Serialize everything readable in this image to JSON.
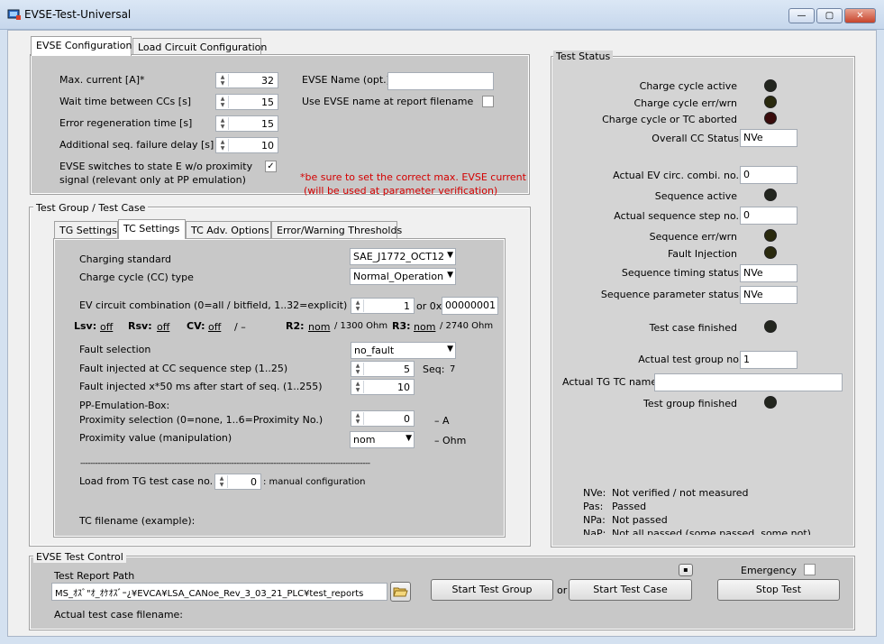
{
  "window": {
    "title": "EVSE-Test-Universal",
    "minimize": "—",
    "maximize": "▢",
    "close": "✕"
  },
  "config_tabs": [
    "EVSE Configuration",
    "Load Circuit Configuration"
  ],
  "config": {
    "max_current_label": "Max. current [A]*",
    "max_current": "32",
    "wait_time_label": "Wait time between CCs [s]",
    "wait_time": "15",
    "error_regen_label": "Error regeneration time [s]",
    "error_regen": "15",
    "add_seq_failure_label": "Additional seq. failure delay [s]",
    "add_seq_failure": "10",
    "switches_label_1": "EVSE switches to state E w/o proximity",
    "switches_label_2": "signal (relevant only at PP emulation)",
    "switches_checked": "✓",
    "evse_name_label": "EVSE Name (opt.)",
    "evse_name": "",
    "use_name_label": "Use EVSE name at report filename",
    "warning_1": "*be sure to set the correct max. EVSE current",
    "warning_2": "(will be used at parameter verification)"
  },
  "test_group": {
    "title": "Test Group / Test Case",
    "tabs": [
      "TG Settings",
      "TC Settings",
      "TC Adv. Options",
      "Error/Warning Thresholds"
    ],
    "charging_standard_label": "Charging standard",
    "charging_standard": "SAE_J1772_OCT12",
    "cc_type_label": "Charge cycle (CC) type",
    "cc_type": "Normal_Operation",
    "ev_circuit_label": "EV circuit combination (0=all / bitfield, 1..32=explicit)",
    "ev_circuit": "1",
    "or_label": "or 0x",
    "ev_circuit_hex": "00000001",
    "lsv_label": "Lsv:",
    "lsv": "off",
    "rsv_label": "Rsv:",
    "rsv": "off",
    "cv_label": "CV:",
    "cv": "off",
    "cv_unit": "/ –",
    "r2_label": "R2:",
    "r2": "nom",
    "r2_unit": "/ 1300 Ohm",
    "r3_label": "R3:",
    "r3": "nom",
    "r3_unit": "/ 2740 Ohm",
    "fault_selection_label": "Fault selection",
    "fault_selection": "no_fault",
    "fault_step_label": "Fault injected at CC sequence step (1..25)",
    "fault_step": "5",
    "seq_label": "Seq:",
    "seq": "7",
    "fault_time_label": "Fault injected x*50 ms after start of seq. (1..255)",
    "fault_time": "10",
    "pp_box_label": "PP-Emulation-Box:",
    "prox_sel_label": "Proximity selection (0=none, 1..6=Proximity No.)",
    "prox_sel": "0",
    "prox_sel_unit": "– A",
    "prox_val_label": "Proximity value (manipulation)",
    "prox_val": "nom",
    "prox_val_unit": "– Ohm",
    "separator": "---------------------------------------------------------------------------------------------------------------------",
    "load_label": "Load from TG test case no.",
    "load_value": "0",
    "load_desc": ": manual configuration",
    "tc_filename_label": "TC filename (example):"
  },
  "status": {
    "title": "Test Status",
    "charge_cycle_active": "Charge cycle active",
    "charge_cycle_err": "Charge cycle err/wrn",
    "charge_cycle_aborted": "Charge cycle or TC aborted",
    "overall_cc_label": "Overall CC Status",
    "overall_cc": "NVe",
    "actual_ev_label": "Actual EV circ. combi. no.",
    "actual_ev": "0",
    "seq_active": "Sequence active",
    "actual_seq_label": "Actual sequence step no.",
    "actual_seq": "0",
    "seq_err": "Sequence err/wrn",
    "fault_injection": "Fault Injection",
    "seq_timing_label": "Sequence timing status",
    "seq_timing": "NVe",
    "seq_param_label": "Sequence parameter status",
    "seq_param": "NVe",
    "tc_finished": "Test case finished",
    "actual_tg_label": "Actual test group no",
    "actual_tg": "1",
    "actual_tg_tc_label": "Actual TG TC name",
    "actual_tg_tc": "",
    "tg_finished": "Test group finished",
    "legend": [
      {
        "k": "NVe:",
        "v": "Not verified / not measured"
      },
      {
        "k": "Pas:",
        "v": "Passed"
      },
      {
        "k": "NPa:",
        "v": "Not passed"
      },
      {
        "k": "NaP:",
        "v": "Not all passed  (some passed, some not)"
      }
    ]
  },
  "control": {
    "title": "EVSE Test Control",
    "report_path_label": "Test Report Path",
    "report_path": "MS_ｵｽﾞ\"ｵ_ｵｹｵｽﾞｰ¿¥EVCA¥LSA_CANoe_Rev_3_03_21_PLC¥test_reports",
    "start_group": "Start Test Group",
    "or": "or",
    "start_case": "Start Test Case",
    "emergency_label": "Emergency",
    "stop": "Stop Test",
    "actual_filename_label": "Actual test case filename:",
    "mini": "▪"
  }
}
